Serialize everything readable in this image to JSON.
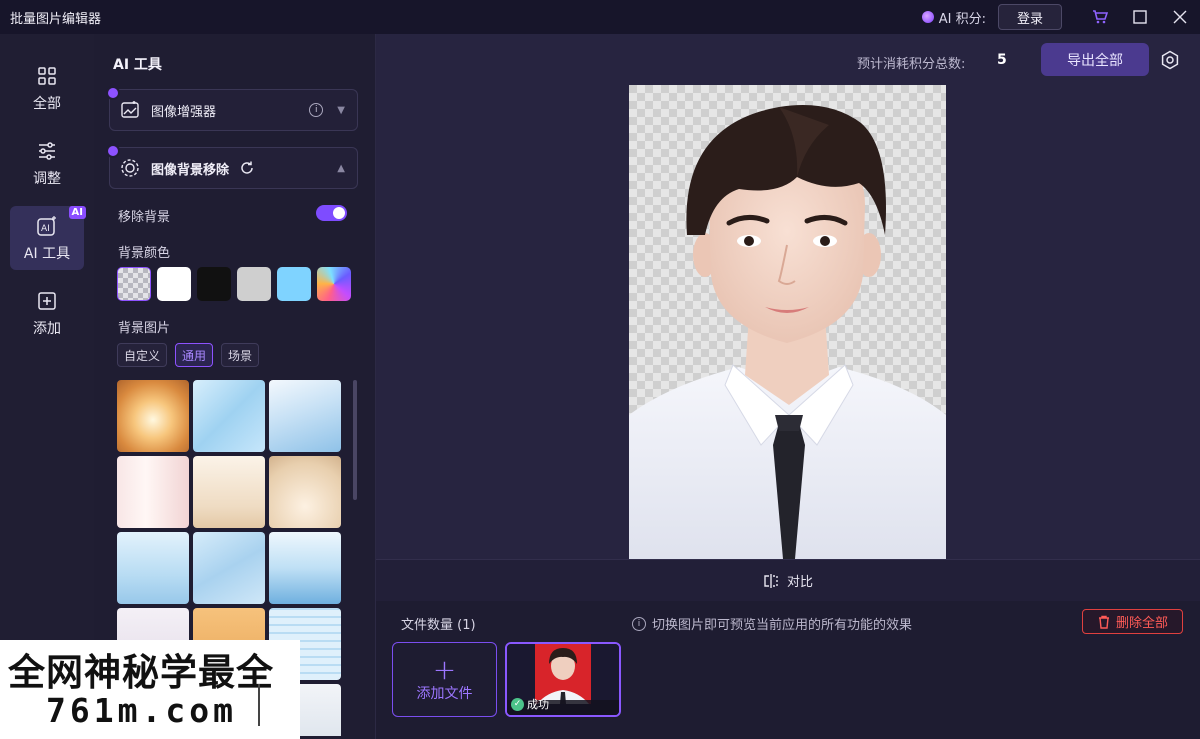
{
  "window": {
    "title": "批量图片编辑器",
    "ai_credits_label": "AI 积分:",
    "login_label": "登录"
  },
  "rail": {
    "items": [
      {
        "label": "全部",
        "icon": "grid-icon"
      },
      {
        "label": "调整",
        "icon": "sliders-icon"
      },
      {
        "label": "AI 工具",
        "icon": "ai-tools-icon",
        "badge": "AI",
        "active": true
      },
      {
        "label": "添加",
        "icon": "add-square-icon"
      }
    ]
  },
  "panel": {
    "title": "AI 工具",
    "enhancer_label": "图像增强器",
    "bg_remove_label": "图像背景移除",
    "remove_bg_label": "移除背景",
    "remove_bg_on": true,
    "bg_color_label": "背景颜色",
    "bg_colors": [
      "transparent",
      "#ffffff",
      "#111111",
      "#cfcfcf",
      "#7fd3ff",
      "rainbow"
    ],
    "bg_image_label": "背景图片",
    "bg_image_tabs": [
      "自定义",
      "通用",
      "场景"
    ],
    "bg_image_tab_selected": "通用"
  },
  "main": {
    "estimate_label": "预计消耗积分总数:",
    "estimate_value": "5",
    "export_label": "导出全部",
    "compare_label": "对比",
    "file_count_label": "文件数量 (1)",
    "tip_text": "切换图片即可预览当前应用的所有功能的效果",
    "delete_all_label": "删除全部",
    "add_file_label": "添加文件",
    "file_status": "成功"
  },
  "watermark": {
    "line1": "全网神秘学最全",
    "line2": "761m.com"
  },
  "colors": {
    "accent": "#8d52ff",
    "danger": "#ff5b57",
    "background": "#1c1a2d"
  }
}
